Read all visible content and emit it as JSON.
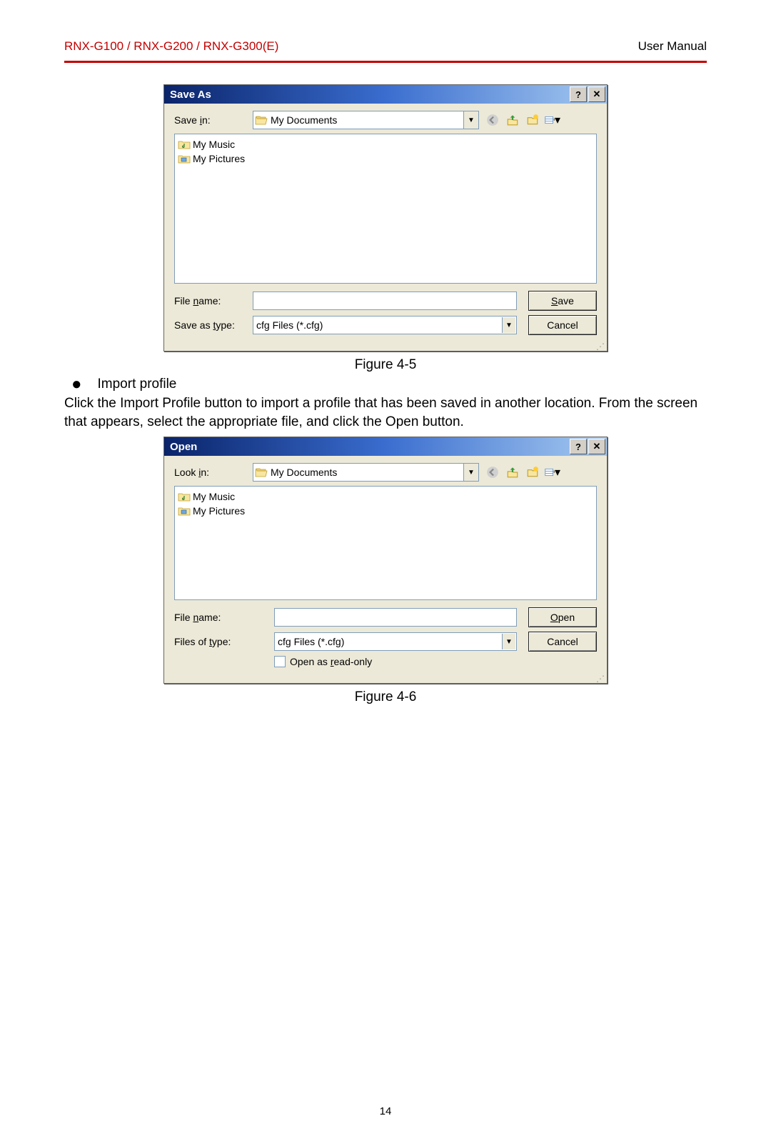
{
  "header": {
    "left": "RNX-G100 / RNX-G200 / RNX-G300(E)",
    "right": "User Manual"
  },
  "save_dialog": {
    "title": "Save As",
    "save_in_label": "Save in:",
    "folder": "My Documents",
    "files": [
      {
        "name": "My Music"
      },
      {
        "name": "My Pictures"
      }
    ],
    "filename_label": "File name:",
    "filename_value": "",
    "type_label": "Save as type:",
    "type_value": "cfg Files (*.cfg)",
    "save_btn": "Save",
    "cancel_btn": "Cancel"
  },
  "figure1_caption": "Figure 4-5",
  "bullet_text": "Import profile",
  "body_paragraph": "Click the Import Profile button to import a profile that has been saved in another location. From the screen that appears, select the appropriate file, and click the Open button.",
  "open_dialog": {
    "title": "Open",
    "look_in_label": "Look in:",
    "folder": "My Documents",
    "files": [
      {
        "name": "My Music"
      },
      {
        "name": "My Pictures"
      }
    ],
    "filename_label": "File name:",
    "filename_value": "",
    "type_label": "Files of type:",
    "type_value": "cfg Files (*.cfg)",
    "readonly_label": "Open as read-only",
    "open_btn": "Open",
    "cancel_btn": "Cancel"
  },
  "figure2_caption": "Figure 4-6",
  "page_number": "14"
}
